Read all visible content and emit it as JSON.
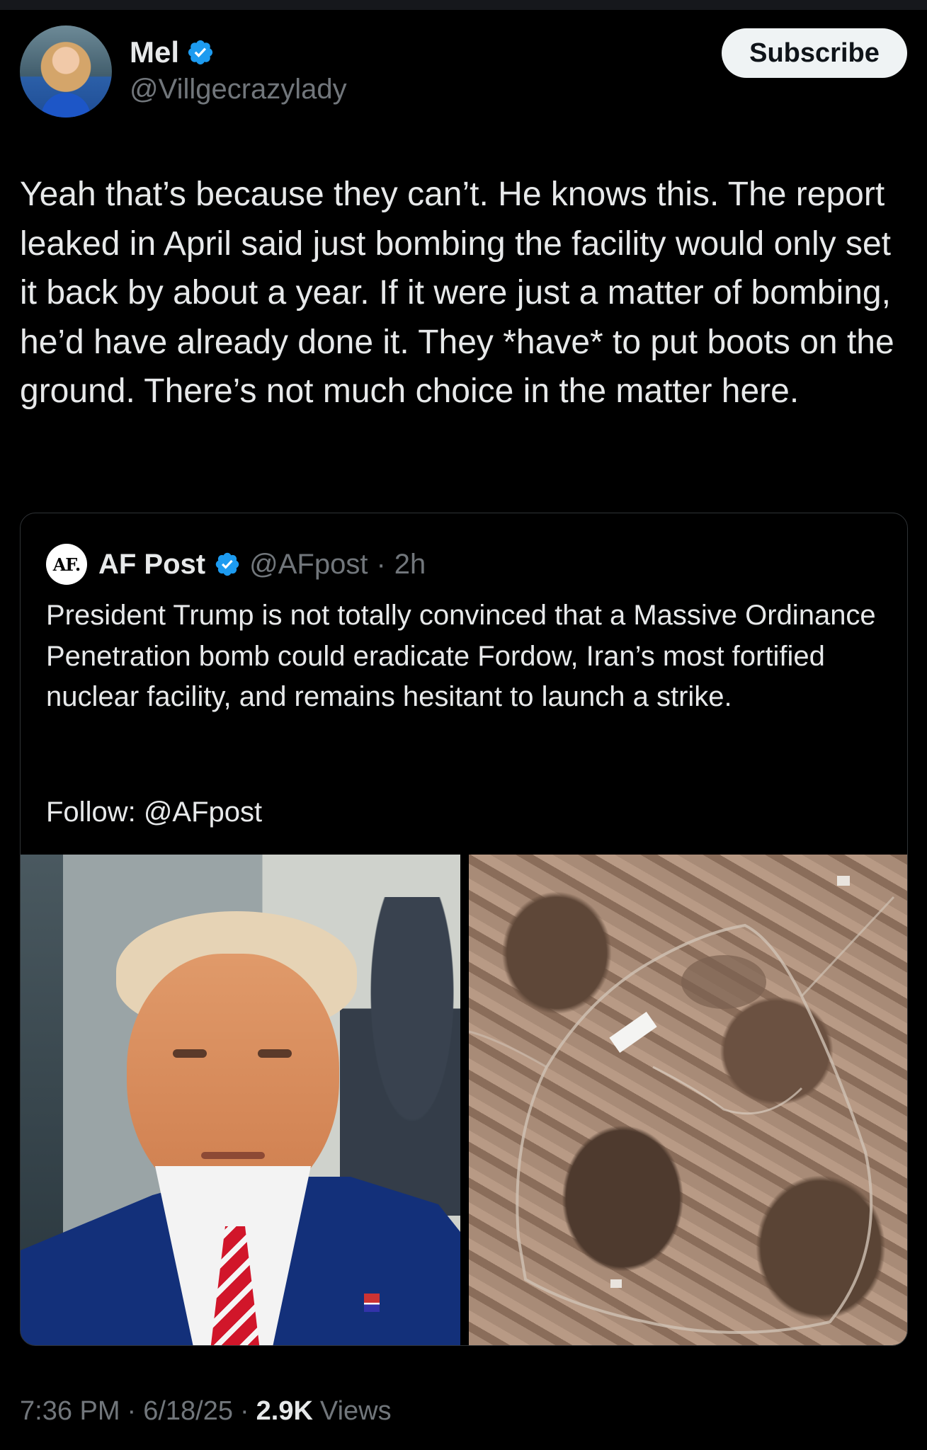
{
  "author": {
    "name": "Mel",
    "handle": "@Villgecrazylady",
    "verified": true,
    "avatar_icon": "profile-avatar"
  },
  "subscribe_label": "Subscribe",
  "tweet_text": "Yeah that’s because they can’t. He knows this. The report leaked in April said just bombing the facility would only set it back by about a year. If it were just a matter of bombing, he’d have already done it. They *have* to put boots on the ground. There’s not much choice in the matter here.",
  "quote": {
    "logo_text": "AF.",
    "name": "AF Post",
    "handle": "@AFpost",
    "separator": "·",
    "time": "2h",
    "text": "President Trump is not totally convinced that a Massive Ordinance Penetration bomb could eradicate Fordow, Iran’s most fortified nuclear facility, and remains hesitant to launch a strike.",
    "follow": "Follow: @AFpost",
    "media": [
      "portrait-photo",
      "satellite-image"
    ]
  },
  "meta": {
    "time": "7:36 PM",
    "sep1": "·",
    "date": "6/18/25",
    "sep2": "·",
    "views_count": "2.9K",
    "views_label": "Views"
  },
  "colors": {
    "background": "#000000",
    "text": "#e7e9ea",
    "secondary": "#71767b",
    "verified": "#1d9bf0",
    "border": "#2f3336"
  }
}
